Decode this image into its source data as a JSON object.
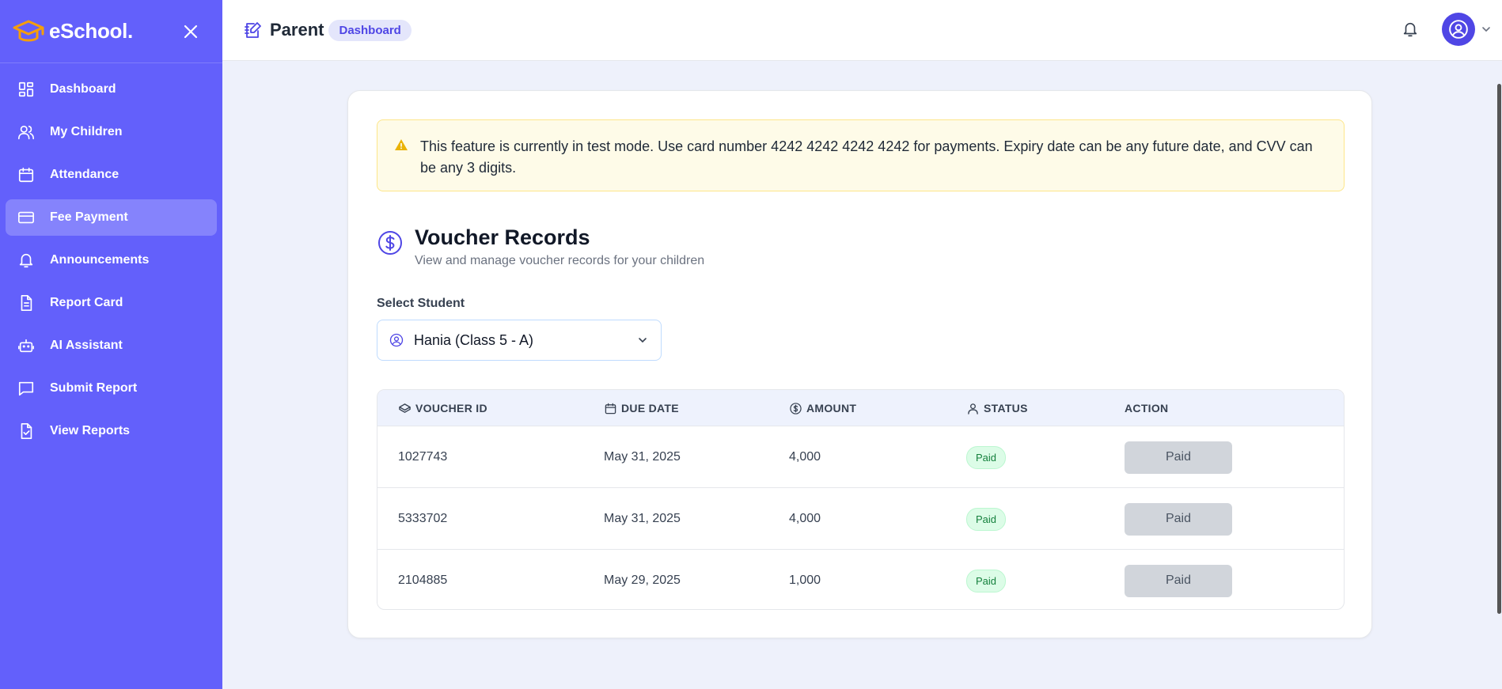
{
  "brand": {
    "name": "eSchool.",
    "accent": "#f59e0b"
  },
  "sidebar": {
    "background": "#6360fb",
    "items": [
      {
        "label": "Dashboard",
        "icon": "dashboard-icon",
        "active": false
      },
      {
        "label": "My Children",
        "icon": "users-icon",
        "active": false
      },
      {
        "label": "Attendance",
        "icon": "calendar-icon",
        "active": false
      },
      {
        "label": "Fee Payment",
        "icon": "credit-card-icon",
        "active": true
      },
      {
        "label": "Announcements",
        "icon": "bell-icon",
        "active": false
      },
      {
        "label": "Report Card",
        "icon": "document-icon",
        "active": false
      },
      {
        "label": "AI Assistant",
        "icon": "robot-icon",
        "active": false
      },
      {
        "label": "Submit Report",
        "icon": "message-icon",
        "active": false
      },
      {
        "label": "View Reports",
        "icon": "file-check-icon",
        "active": false
      }
    ]
  },
  "header": {
    "title": "Parent",
    "badge": "Dashboard"
  },
  "alert": {
    "text": "This feature is currently in test mode. Use card number 4242 4242 4242 4242 for payments. Expiry date can be any future date, and CVV can be any 3 digits."
  },
  "main": {
    "title": "Voucher Records",
    "subtitle": "View and manage voucher records for your children",
    "select_label": "Select Student",
    "selected_student": "Hania (Class 5 - A)"
  },
  "table": {
    "headers": {
      "voucher_id": "VOUCHER ID",
      "due_date": "DUE DATE",
      "amount": "AMOUNT",
      "status": "STATUS",
      "action": "ACTION"
    },
    "rows": [
      {
        "voucher_id": "1027743",
        "due_date": "May 31, 2025",
        "amount": "4,000",
        "status": "Paid",
        "action": "Paid"
      },
      {
        "voucher_id": "5333702",
        "due_date": "May 31, 2025",
        "amount": "4,000",
        "status": "Paid",
        "action": "Paid"
      },
      {
        "voucher_id": "2104885",
        "due_date": "May 29, 2025",
        "amount": "1,000",
        "status": "Paid",
        "action": "Paid"
      }
    ]
  }
}
